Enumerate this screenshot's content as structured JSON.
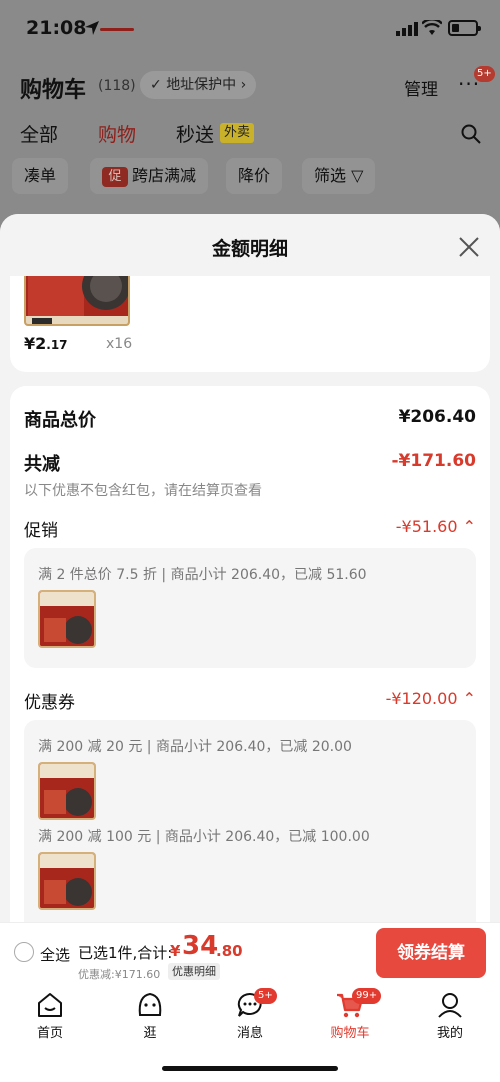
{
  "status_bar": {
    "time": "21:08"
  },
  "cart_header": {
    "title": "购物车",
    "count": "(118)",
    "address": "地址保护中 ›",
    "manage": "管理",
    "more": "···",
    "more_badge": "5+"
  },
  "tabs": [
    {
      "label": "全部"
    },
    {
      "label": "购物"
    },
    {
      "label": "秒送"
    }
  ],
  "waimai_tag": "外卖",
  "filters": {
    "items": [
      {
        "label": "凑单"
      },
      {
        "badge": "促",
        "label": "跨店满减"
      },
      {
        "label": "降价"
      },
      {
        "label": "筛选 ▽"
      }
    ]
  },
  "sheet": {
    "title": "金额明细",
    "top_item": {
      "price_main": "¥2",
      "price_dec": ".17",
      "qty": "x16"
    },
    "total_label": "商品总价",
    "total_value": "¥206.40",
    "reduce_label": "共减",
    "reduce_value": "-¥171.60",
    "note": "以下优惠不包含红包，请在结算页查看",
    "promo": {
      "label": "促销",
      "value": "-¥51.60 ⌃",
      "line": "满 2 件总价 7.5 折 | 商品小计 206.40，已减 51.60"
    },
    "coupon": {
      "label": "优惠券",
      "value": "-¥120.00 ⌃",
      "lines": [
        "满 200 减 20 元 | 商品小计 206.40，已减 20.00",
        "满 200 减 100 元 | 商品小计 206.40，已减 100.00"
      ]
    }
  },
  "checkout": {
    "select_all": "全选",
    "selected": "已选1件,合计:",
    "currency": "¥",
    "total_int": "34",
    "total_dec": ".80",
    "discount": "优惠减:¥171.60",
    "detail": "优惠明细",
    "pay": "领券结算"
  },
  "tabbar": {
    "items": [
      {
        "label": "首页"
      },
      {
        "label": "逛"
      },
      {
        "label": "消息",
        "badge": "5+"
      },
      {
        "label": "购物车",
        "badge": "99+"
      },
      {
        "label": "我的"
      }
    ]
  },
  "colors": {
    "accent": "#e23a2e",
    "price_red": "#d83a2c",
    "pay_button": "#e8493f"
  }
}
